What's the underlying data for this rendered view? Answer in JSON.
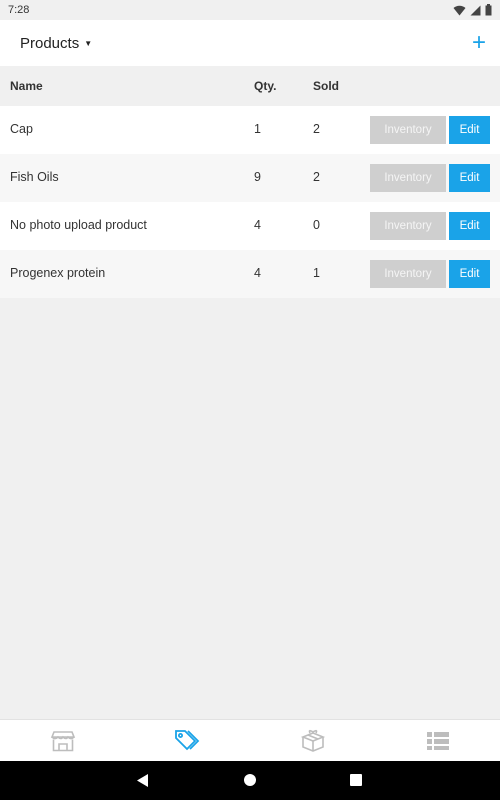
{
  "status": {
    "time": "7:28"
  },
  "header": {
    "title": "Products",
    "add_label": "+"
  },
  "table": {
    "columns": {
      "name": "Name",
      "qty": "Qty.",
      "sold": "Sold"
    },
    "rows": [
      {
        "name": "Cap",
        "qty": "1",
        "sold": "2"
      },
      {
        "name": "Fish Oils",
        "qty": "9",
        "sold": "2"
      },
      {
        "name": "No photo upload product",
        "qty": "4",
        "sold": "0"
      },
      {
        "name": "Progenex protein",
        "qty": "4",
        "sold": "1"
      }
    ],
    "inventory_label": "Inventory",
    "edit_label": "Edit"
  },
  "bottom_nav": {
    "items": [
      {
        "icon": "store-icon",
        "active": false
      },
      {
        "icon": "tags-icon",
        "active": true
      },
      {
        "icon": "gift-box-icon",
        "active": false
      },
      {
        "icon": "list-icon",
        "active": false
      }
    ]
  },
  "colors": {
    "accent": "#1aa3e8",
    "inventory_button": "#cfcfcf",
    "icon_inactive": "#bdbdbd"
  }
}
